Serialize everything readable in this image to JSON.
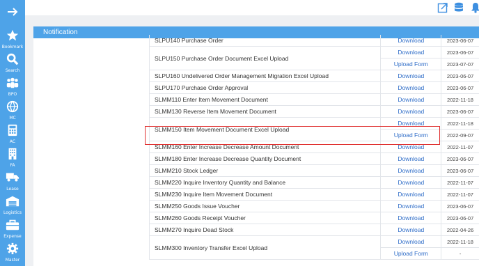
{
  "sidebar": {
    "items": [
      {
        "label": "Bookmark",
        "icon": "star-icon"
      },
      {
        "label": "Search",
        "icon": "search-icon"
      },
      {
        "label": "BPO",
        "icon": "people-icon"
      },
      {
        "label": "MC",
        "icon": "globe-icon"
      },
      {
        "label": "AC",
        "icon": "calculator-icon"
      },
      {
        "label": "FA",
        "icon": "building-icon"
      },
      {
        "label": "Lease",
        "icon": "truck-icon"
      },
      {
        "label": "Logistics",
        "icon": "warehouse-icon"
      },
      {
        "label": "Expense",
        "icon": "briefcase-icon"
      },
      {
        "label": "Master",
        "icon": "gear-icon"
      }
    ]
  },
  "panel": {
    "title": "Notification"
  },
  "rows": [
    {
      "name": "SLPU140 Purchase Order",
      "links": [
        {
          "action": "Download",
          "date": "2023-06-07"
        }
      ]
    },
    {
      "name": "SLPU150 Purchase Order Document Excel Upload",
      "links": [
        {
          "action": "Download",
          "date": "2023-06-07"
        },
        {
          "action": "Upload Form",
          "date": "2023-07-07"
        }
      ]
    },
    {
      "name": "SLPU160 Undelivered Order Management Migration Excel Upload",
      "links": [
        {
          "action": "Download",
          "date": "2023-06-07"
        }
      ]
    },
    {
      "name": "SLPU170 Purchase Order Approval",
      "links": [
        {
          "action": "Download",
          "date": "2023-06-07"
        }
      ]
    },
    {
      "name": "SLMM110 Enter Item Movement Document",
      "links": [
        {
          "action": "Download",
          "date": "2022-11-18"
        }
      ]
    },
    {
      "name": "SLMM130 Reverse Item Movement Document",
      "links": [
        {
          "action": "Download",
          "date": "2023-06-07"
        }
      ]
    },
    {
      "name": "SLMM150 Item Movement Document Excel Upload",
      "links": [
        {
          "action": "Download",
          "date": "2022-11-18"
        },
        {
          "action": "Upload Form",
          "date": "2022-09-07"
        }
      ]
    },
    {
      "name": "SLMM160 Enter Increase Decrease Amount Document",
      "links": [
        {
          "action": "Download",
          "date": "2022-11-07"
        }
      ]
    },
    {
      "name": "SLMM180 Enter Increase Decrease Quantity Document",
      "links": [
        {
          "action": "Download",
          "date": "2023-06-07"
        }
      ]
    },
    {
      "name": "SLMM210 Stock Ledger",
      "links": [
        {
          "action": "Download",
          "date": "2023-06-07"
        }
      ]
    },
    {
      "name": "SLMM220 Inquire Inventory Quantity and Balance",
      "links": [
        {
          "action": "Download",
          "date": "2022-11-07"
        }
      ]
    },
    {
      "name": "SLMM230 Inquire Item Movement Document",
      "links": [
        {
          "action": "Download",
          "date": "2022-11-07"
        }
      ]
    },
    {
      "name": "SLMM250 Goods Issue Voucher",
      "links": [
        {
          "action": "Download",
          "date": "2023-06-07"
        }
      ]
    },
    {
      "name": "SLMM260 Goods Receipt Voucher",
      "links": [
        {
          "action": "Download",
          "date": "2023-06-07"
        }
      ]
    },
    {
      "name": "SLMM270 Inquire Dead Stock",
      "links": [
        {
          "action": "Download",
          "date": "2022-04-26"
        }
      ]
    },
    {
      "name": "SLMM300 Inventory Transfer Excel Upload",
      "links": [
        {
          "action": "Download",
          "date": "2022-11-18"
        },
        {
          "action": "Upload Form",
          "date": "-"
        }
      ]
    }
  ],
  "colors": {
    "accent": "#4ea3e8",
    "link": "#2f6dc8",
    "highlight": "#e03030"
  }
}
